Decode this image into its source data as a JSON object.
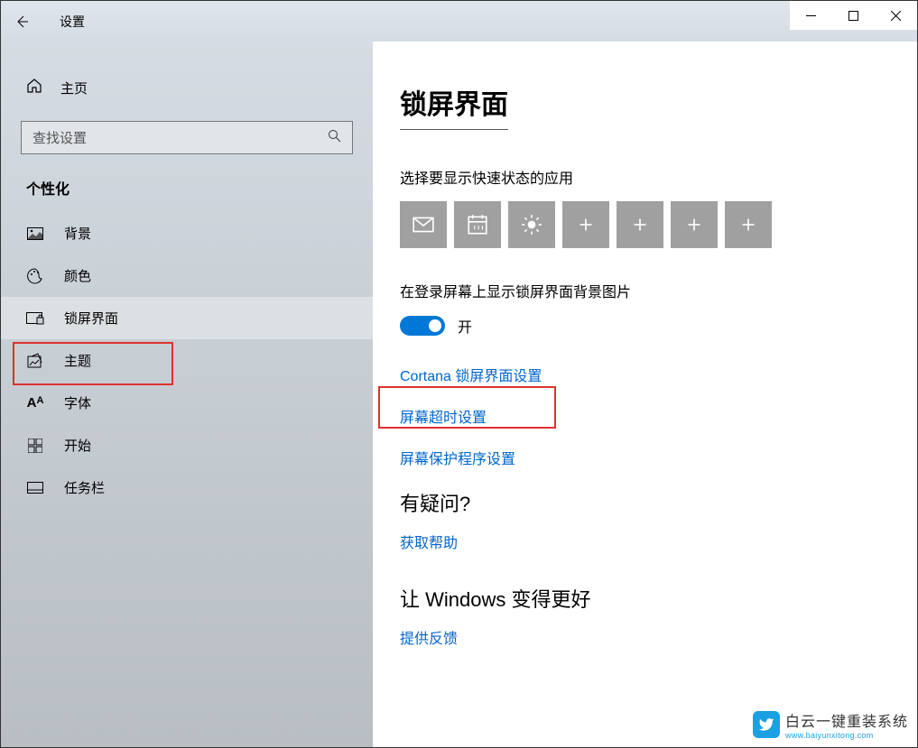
{
  "titlebar": {
    "title": "设置"
  },
  "sidebar": {
    "home": "主页",
    "search_placeholder": "查找设置",
    "section": "个性化",
    "items": [
      {
        "label": "背景"
      },
      {
        "label": "颜色"
      },
      {
        "label": "锁屏界面"
      },
      {
        "label": "主题"
      },
      {
        "label": "字体"
      },
      {
        "label": "开始"
      },
      {
        "label": "任务栏"
      }
    ]
  },
  "content": {
    "title": "锁屏界面",
    "quick_status_label": "选择要显示快速状态的应用",
    "bg_toggle_label": "在登录屏幕上显示锁屏界面背景图片",
    "toggle_state": "开",
    "link_cortana": "Cortana 锁屏界面设置",
    "link_timeout": "屏幕超时设置",
    "link_screensaver": "屏幕保护程序设置",
    "help_heading": "有疑问?",
    "link_help": "获取帮助",
    "better_heading": "让 Windows 变得更好",
    "link_feedback": "提供反馈"
  },
  "watermark": {
    "main": "白云一键重装系统",
    "sub": "www.baiyunxitong.com"
  }
}
